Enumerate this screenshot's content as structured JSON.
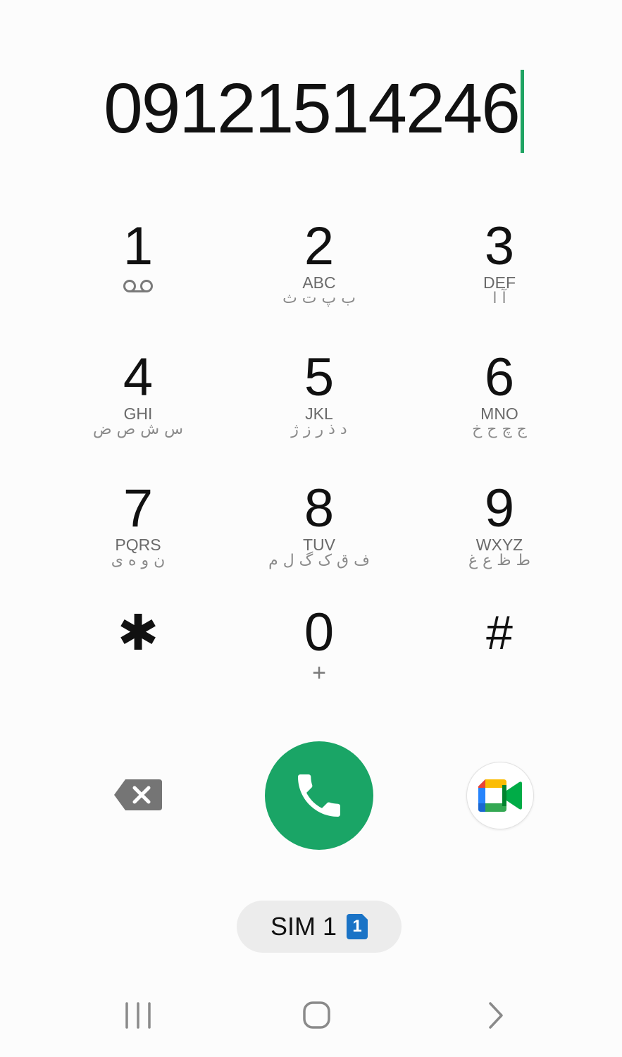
{
  "dialer": {
    "number": "09121514246",
    "cursor_color": "#1fa463"
  },
  "keypad": {
    "keys": [
      {
        "digit": "1",
        "letters": "",
        "persian": "",
        "sub_icon": "voicemail-icon"
      },
      {
        "digit": "2",
        "letters": "ABC",
        "persian": "ب پ ت ث"
      },
      {
        "digit": "3",
        "letters": "DEF",
        "persian": "آ ا"
      },
      {
        "digit": "4",
        "letters": "GHI",
        "persian": "س ش ص ض"
      },
      {
        "digit": "5",
        "letters": "JKL",
        "persian": "د ذ ر ز ژ"
      },
      {
        "digit": "6",
        "letters": "MNO",
        "persian": "ج چ ح خ"
      },
      {
        "digit": "7",
        "letters": "PQRS",
        "persian": "ن و ه ی"
      },
      {
        "digit": "8",
        "letters": "TUV",
        "persian": "ف ق ک گ ل م"
      },
      {
        "digit": "9",
        "letters": "WXYZ",
        "persian": "ط ظ ع غ"
      },
      {
        "digit": "✱",
        "letters": "",
        "persian": ""
      },
      {
        "digit": "0",
        "letters": "",
        "persian": "",
        "sub": "+"
      },
      {
        "digit": "#",
        "letters": "",
        "persian": ""
      }
    ]
  },
  "actions": {
    "backspace_icon": "backspace-icon",
    "call_icon": "phone-icon",
    "call_color": "#1aa566",
    "video_icon": "google-meet-icon"
  },
  "sim": {
    "label": "SIM 1",
    "badge": "1",
    "badge_color": "#1a73c6"
  },
  "navbar": {
    "recent_icon": "recent-apps-icon",
    "home_icon": "home-icon",
    "back_icon": "back-icon"
  }
}
